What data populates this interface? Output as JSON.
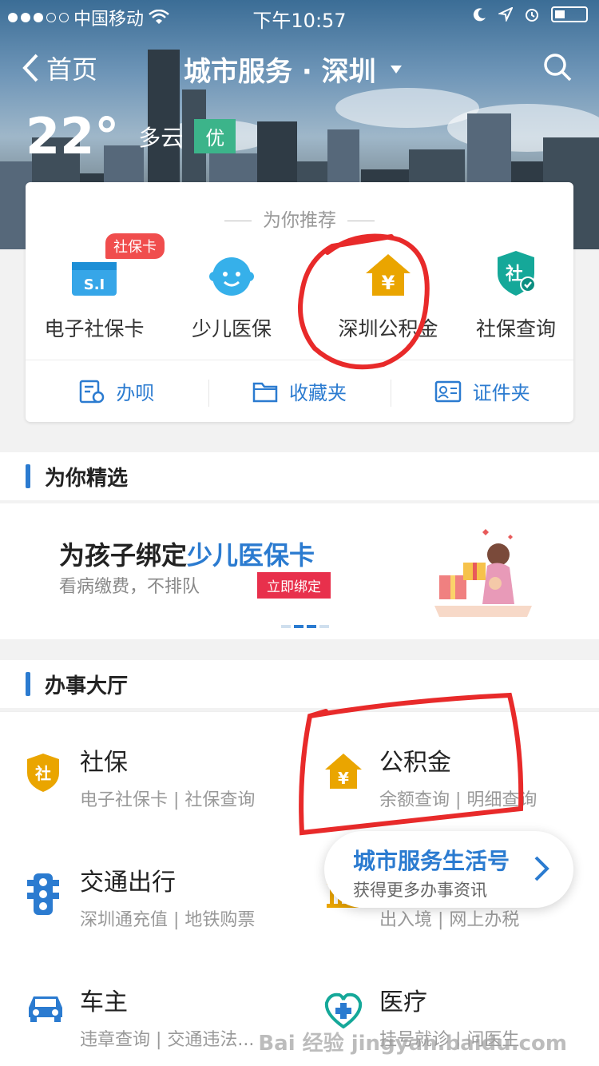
{
  "status": {
    "carrier": "中国移动",
    "time": "下午10:57"
  },
  "nav": {
    "back": "首页",
    "title": "城市服务 · 深圳",
    "dropdown_icon": "triangle-down-icon",
    "search_icon": "search-icon"
  },
  "weather": {
    "temp": "22°",
    "condition": "多云",
    "aqi": "优"
  },
  "recommend": {
    "heading": "为你推荐",
    "items": [
      {
        "label": "电子社保卡",
        "icon": "si-card-icon",
        "badge": "社保卡"
      },
      {
        "label": "少儿医保",
        "icon": "child-face-icon"
      },
      {
        "label": "深圳公积金",
        "icon": "house-yuan-icon"
      },
      {
        "label": "社保查询",
        "icon": "shield-check-icon"
      }
    ],
    "tools": [
      {
        "label": "办呗",
        "icon": "task-icon"
      },
      {
        "label": "收藏夹",
        "icon": "folder-icon"
      },
      {
        "label": "证件夹",
        "icon": "id-card-icon"
      }
    ]
  },
  "featured": {
    "heading": "为你精选",
    "banner_title_prefix": "为孩子绑定",
    "banner_title_highlight": "少儿医保卡",
    "banner_sub": "看病缴费，不排队",
    "banner_btn": "立即绑定"
  },
  "hall": {
    "heading": "办事大厅",
    "services": [
      {
        "name": "社保",
        "desc": "电子社保卡 | 社保查询",
        "icon": "shield-she-icon"
      },
      {
        "name": "公积金",
        "desc": "余额查询 | 明细查询",
        "icon": "house-yuan-icon"
      },
      {
        "name": "交通出行",
        "desc": "深圳通充值 | 地铁购票",
        "icon": "traffic-light-icon"
      },
      {
        "name": "",
        "desc": "出入境 | 网上办税",
        "icon": "building-icon"
      },
      {
        "name": "车主",
        "desc": "违章查询 | 交通违法...",
        "icon": "car-icon"
      },
      {
        "name": "医疗",
        "desc": "挂号就诊 | 问医生",
        "icon": "medical-icon"
      }
    ]
  },
  "popup": {
    "title": "城市服务生活号",
    "subtitle": "获得更多办事资讯"
  },
  "watermark": "Bai 经验 jingyan.baidu.com",
  "colors": {
    "accent": "#2b7bd0",
    "aqi": "#3cb48a",
    "badge": "#f04d4d",
    "gold": "#e8a200",
    "annotation": "#e82a2a"
  }
}
